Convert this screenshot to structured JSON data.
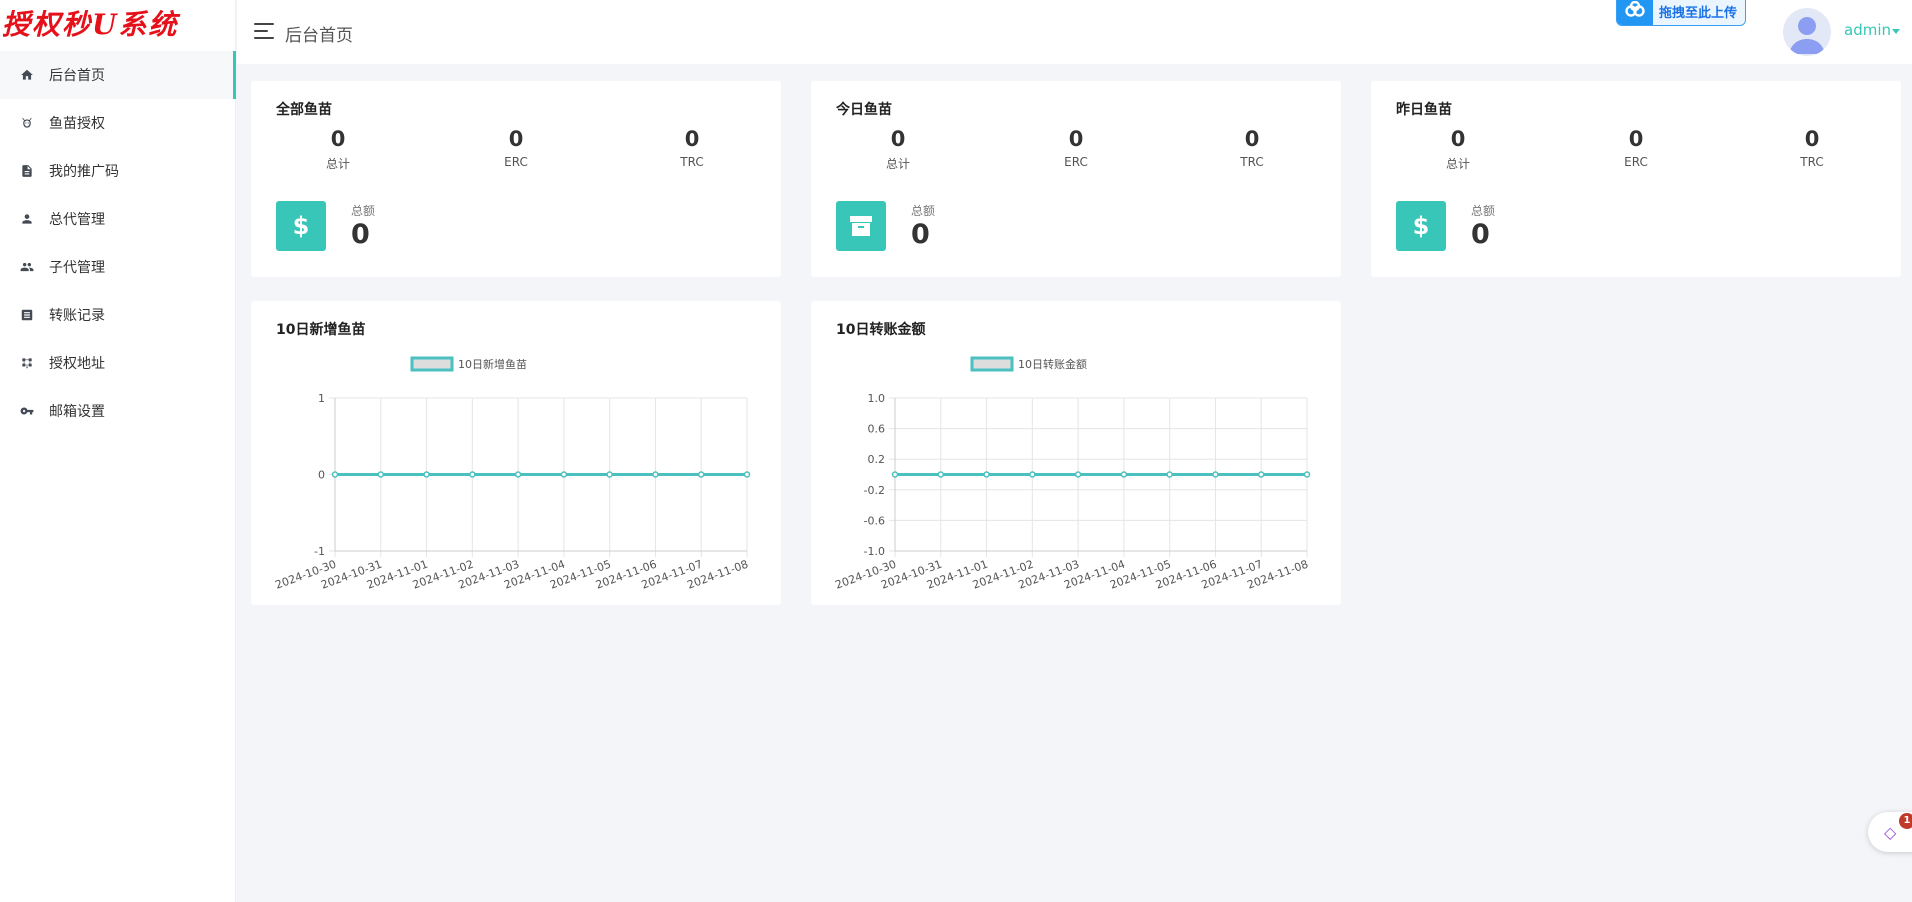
{
  "brand": {
    "logo_text": "授权秒U系统"
  },
  "sidebar": {
    "items": [
      {
        "label": "后台首页",
        "icon": "home-icon",
        "active": true
      },
      {
        "label": "鱼苗授权",
        "icon": "fish-icon",
        "active": false
      },
      {
        "label": "我的推广码",
        "icon": "document-icon",
        "active": false
      },
      {
        "label": "总代管理",
        "icon": "person-icon",
        "active": false
      },
      {
        "label": "子代管理",
        "icon": "group-icon",
        "active": false
      },
      {
        "label": "转账记录",
        "icon": "receipt-icon",
        "active": false
      },
      {
        "label": "授权地址",
        "icon": "network-icon",
        "active": false
      },
      {
        "label": "邮箱设置",
        "icon": "key-icon",
        "active": false
      }
    ]
  },
  "header": {
    "title": "后台首页",
    "upload_label": "拖拽至此上传",
    "user": "admin"
  },
  "stat_cards": [
    {
      "title": "全部鱼苗",
      "stats": [
        {
          "value": "0",
          "label": "总计"
        },
        {
          "value": "0",
          "label": "ERC"
        },
        {
          "value": "0",
          "label": "TRC"
        }
      ],
      "sum_label": "总额",
      "sum_value": "0",
      "sum_icon": "$"
    },
    {
      "title": "今日鱼苗",
      "stats": [
        {
          "value": "0",
          "label": "总计"
        },
        {
          "value": "0",
          "label": "ERC"
        },
        {
          "value": "0",
          "label": "TRC"
        }
      ],
      "sum_label": "总额",
      "sum_value": "0",
      "sum_icon": "archive-icon"
    },
    {
      "title": "昨日鱼苗",
      "stats": [
        {
          "value": "0",
          "label": "总计"
        },
        {
          "value": "0",
          "label": "ERC"
        },
        {
          "value": "0",
          "label": "TRC"
        }
      ],
      "sum_label": "总额",
      "sum_value": "0",
      "sum_icon": "$"
    }
  ],
  "charts": [
    {
      "title": "10日新增鱼苗"
    },
    {
      "title": "10日转账金额"
    }
  ],
  "chart_data": [
    {
      "type": "line",
      "title": "10日新增鱼苗",
      "x": [
        "2024-10-30",
        "2024-10-31",
        "2024-11-01",
        "2024-11-02",
        "2024-11-03",
        "2024-11-04",
        "2024-11-05",
        "2024-11-06",
        "2024-11-07",
        "2024-11-08"
      ],
      "series": [
        {
          "name": "10日新增鱼苗",
          "values": [
            0,
            0,
            0,
            0,
            0,
            0,
            0,
            0,
            0,
            0
          ]
        }
      ],
      "ylim": [
        -1,
        1
      ],
      "yticks": [
        "1",
        "0",
        "-1"
      ],
      "legend": "top-center",
      "grid": true,
      "color": "#4bc0c0"
    },
    {
      "type": "line",
      "title": "10日转账金额",
      "x": [
        "2024-10-30",
        "2024-10-31",
        "2024-11-01",
        "2024-11-02",
        "2024-11-03",
        "2024-11-04",
        "2024-11-05",
        "2024-11-06",
        "2024-11-07",
        "2024-11-08"
      ],
      "series": [
        {
          "name": "10日转账金额",
          "values": [
            0,
            0,
            0,
            0,
            0,
            0,
            0,
            0,
            0,
            0
          ]
        }
      ],
      "ylim": [
        -1,
        1
      ],
      "yticks": [
        "1.0",
        "0.6",
        "0.2",
        "-0.2",
        "-0.6",
        "-1.0"
      ],
      "legend": "top-center",
      "grid": true,
      "color": "#4bc0c0"
    }
  ],
  "float_widget": {
    "badge": "1"
  },
  "colors": {
    "accent": "#37c6b7",
    "brand_red": "#e5101a",
    "chart_line": "#4bc0c0",
    "upload_blue": "#2196f3"
  }
}
